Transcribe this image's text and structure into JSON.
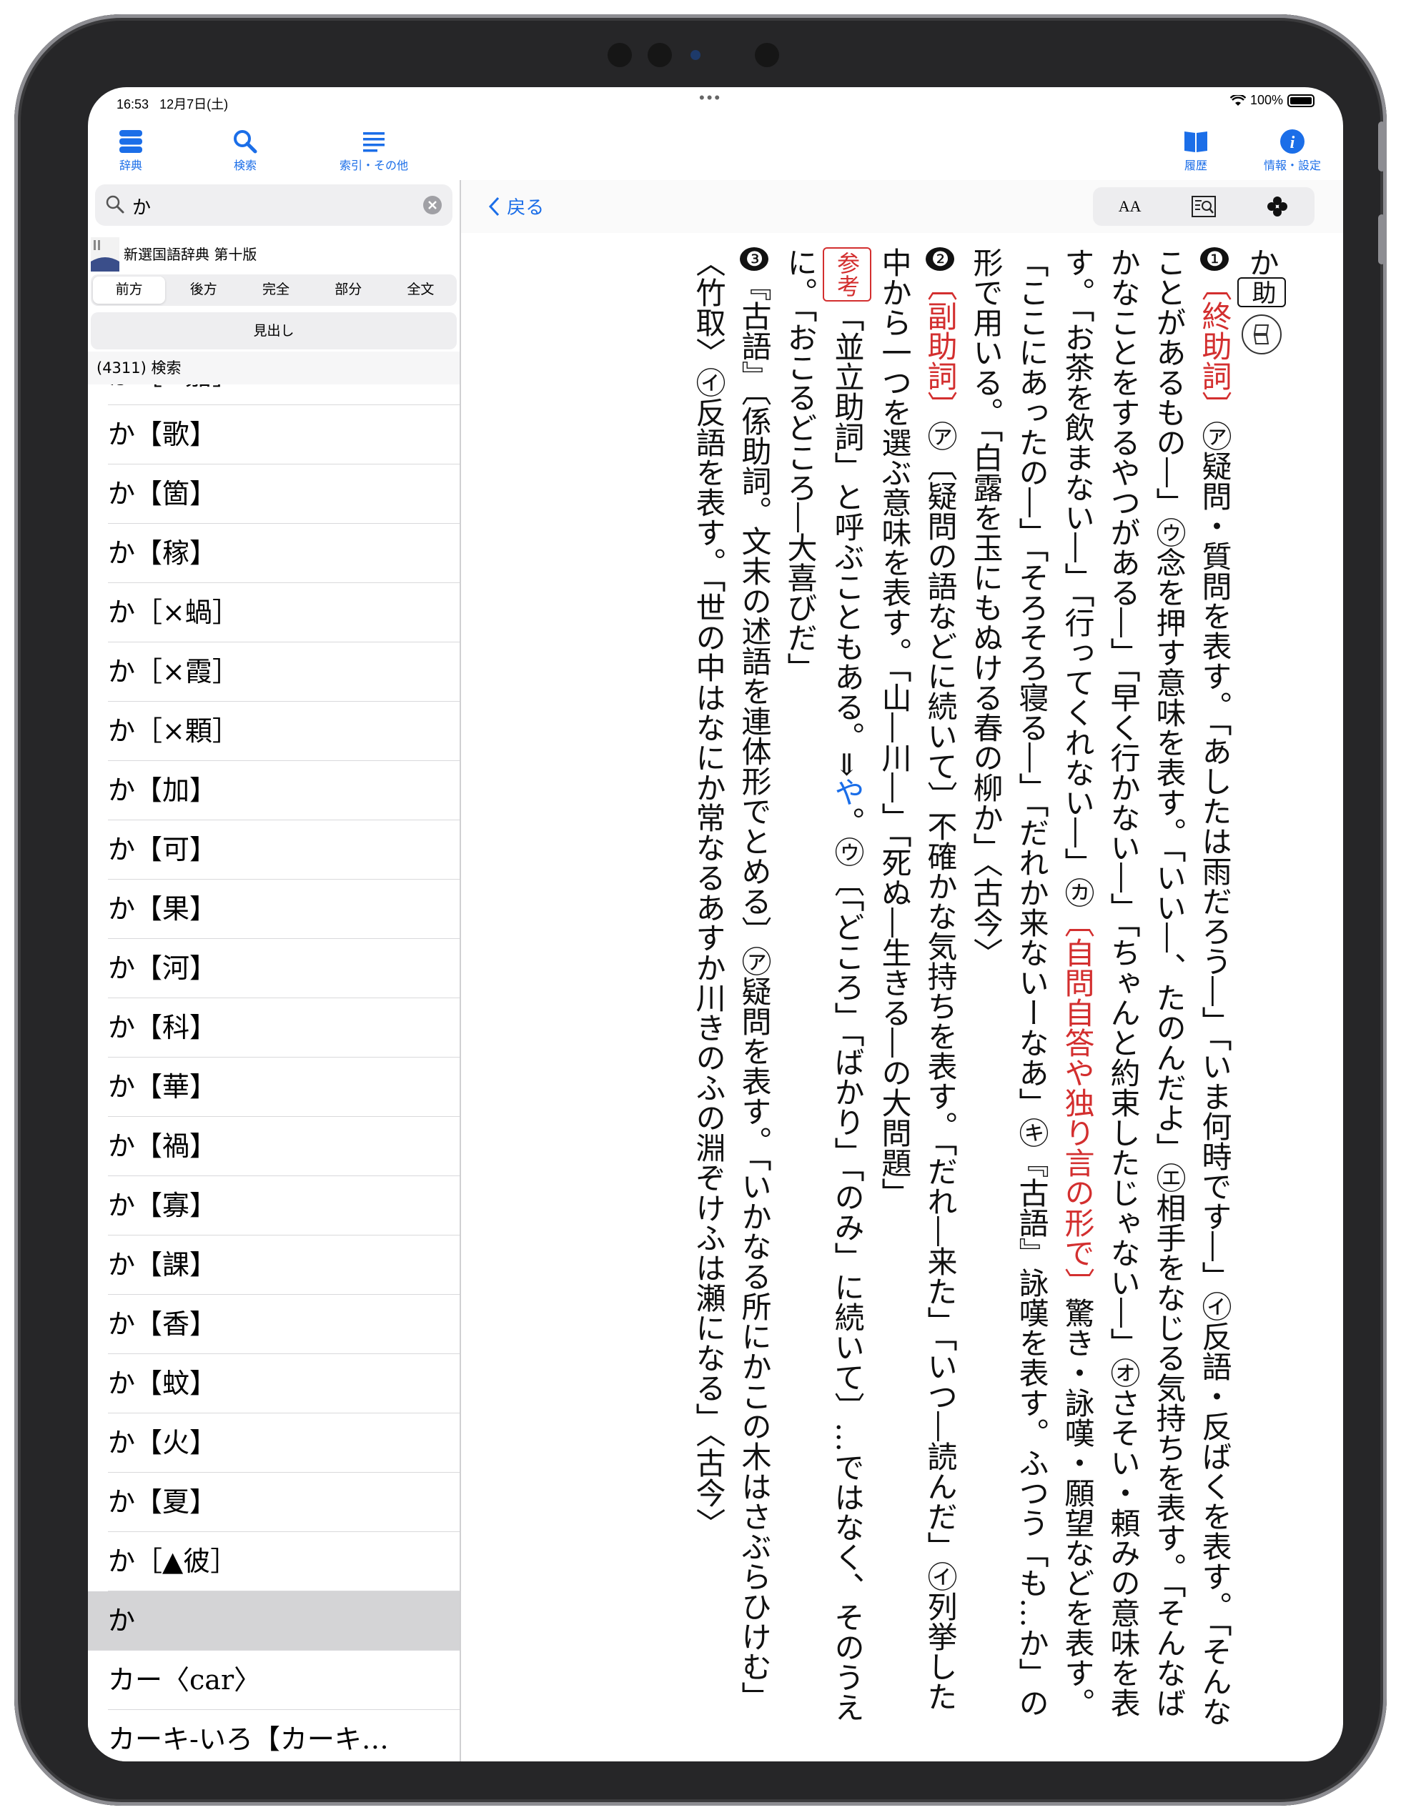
{
  "status": {
    "time": "16:53",
    "date": "12月7日(土)",
    "dots": "•••",
    "battery": "100%"
  },
  "toolbar": {
    "dict_label": "辞典",
    "search_label": "検索",
    "index_label": "索引・その他",
    "history_label": "履歴",
    "info_label": "情報・設定"
  },
  "search": {
    "query": "か"
  },
  "dictionary": {
    "name": "新選国語辞典 第十版"
  },
  "search_modes": [
    "前方",
    "後方",
    "完全",
    "部分",
    "全文"
  ],
  "midashi_label": "見出し",
  "result_count": "(4311) 検索",
  "results": [
    "か［×嘉］",
    "か【歌】",
    "か【箇】",
    "か【稼】",
    "か［×蝸］",
    "か［×霞］",
    "か［×顆］",
    "か【加】",
    "か【可】",
    "か【果】",
    "か【河】",
    "か【科】",
    "か【華】",
    "か【禍】",
    "か【寡】",
    "か【課】",
    "か【香】",
    "か【蚊】",
    "か【火】",
    "か【夏】",
    "か［▲彼］",
    "か",
    "カー〈car〉",
    "カーキ-いろ【カーキ…"
  ],
  "detail": {
    "back_label": "戻る",
    "font_icon_text": "AA",
    "headword": "か",
    "pos_badge": "助",
    "sections": {
      "s1_num": "❶",
      "s1_pos": "〔終助詞〕",
      "s1_text": "㋐疑問・質問を表す。「あしたは雨だろう―」「いま何時です―」㋑反語・反ばくを表す。「そんなことがあるもの―」㋒念を押す意味を表す。「いい―、たのんだよ」㋓相手をなじる気持ちを表す。「そんなばかなことをするやつがある―」「早く行かない―」「ちゃんと約束したじゃない―」㋔さそい・頼みの意味を表す。「お茶を飲まない―」「行ってくれない―」㋕",
      "s1_pos2": "〔自問自答や独り言の形で〕",
      "s1_text2": "驚き・詠嘆・願望などを表す。「ここにあったの―」「そろそろ寝る―」「だれか来ないーなあ」㋖『古語』詠嘆を表す。ふつう「も…か」の形で用いる。「白露を玉にもぬける春の柳か」〈古今〉",
      "s2_num": "❷",
      "s2_pos": "〔副助詞〕",
      "s2_text": "㋐〔疑問の語などに続いて〕不確かな気持ちを表す。「だれ―来た」「いつ―読んだ」㋑列挙した中から一つを選ぶ意味を表す。「山―川―」「死ぬ―生きる―の大問題」",
      "s2_ref_label": "参考",
      "s2_ref": "「並立助詞」と呼ぶこともある。⇒",
      "s2_link": "や",
      "s2_text2": "。㋒〔「どころ」「ばかり」「のみ」に続いて〕…ではなく、そのうえに。「おこるどころ―大喜びだ」",
      "s3_num": "❸",
      "s3_text": "『古語』〔係助詞。文末の述語を連体形でとめる〕㋐疑問を表す。「いかなる所にかこの木はさぶらひけむ」〈竹取〉㋑反語を表す。「世の中はなにか常なるあすか川きのふの淵ぞけふは瀬になる」〈古今〉"
    }
  },
  "colors": {
    "accent": "#1b6ee8",
    "red": "#d32f2f",
    "selected_row": "#d4d4d6"
  }
}
